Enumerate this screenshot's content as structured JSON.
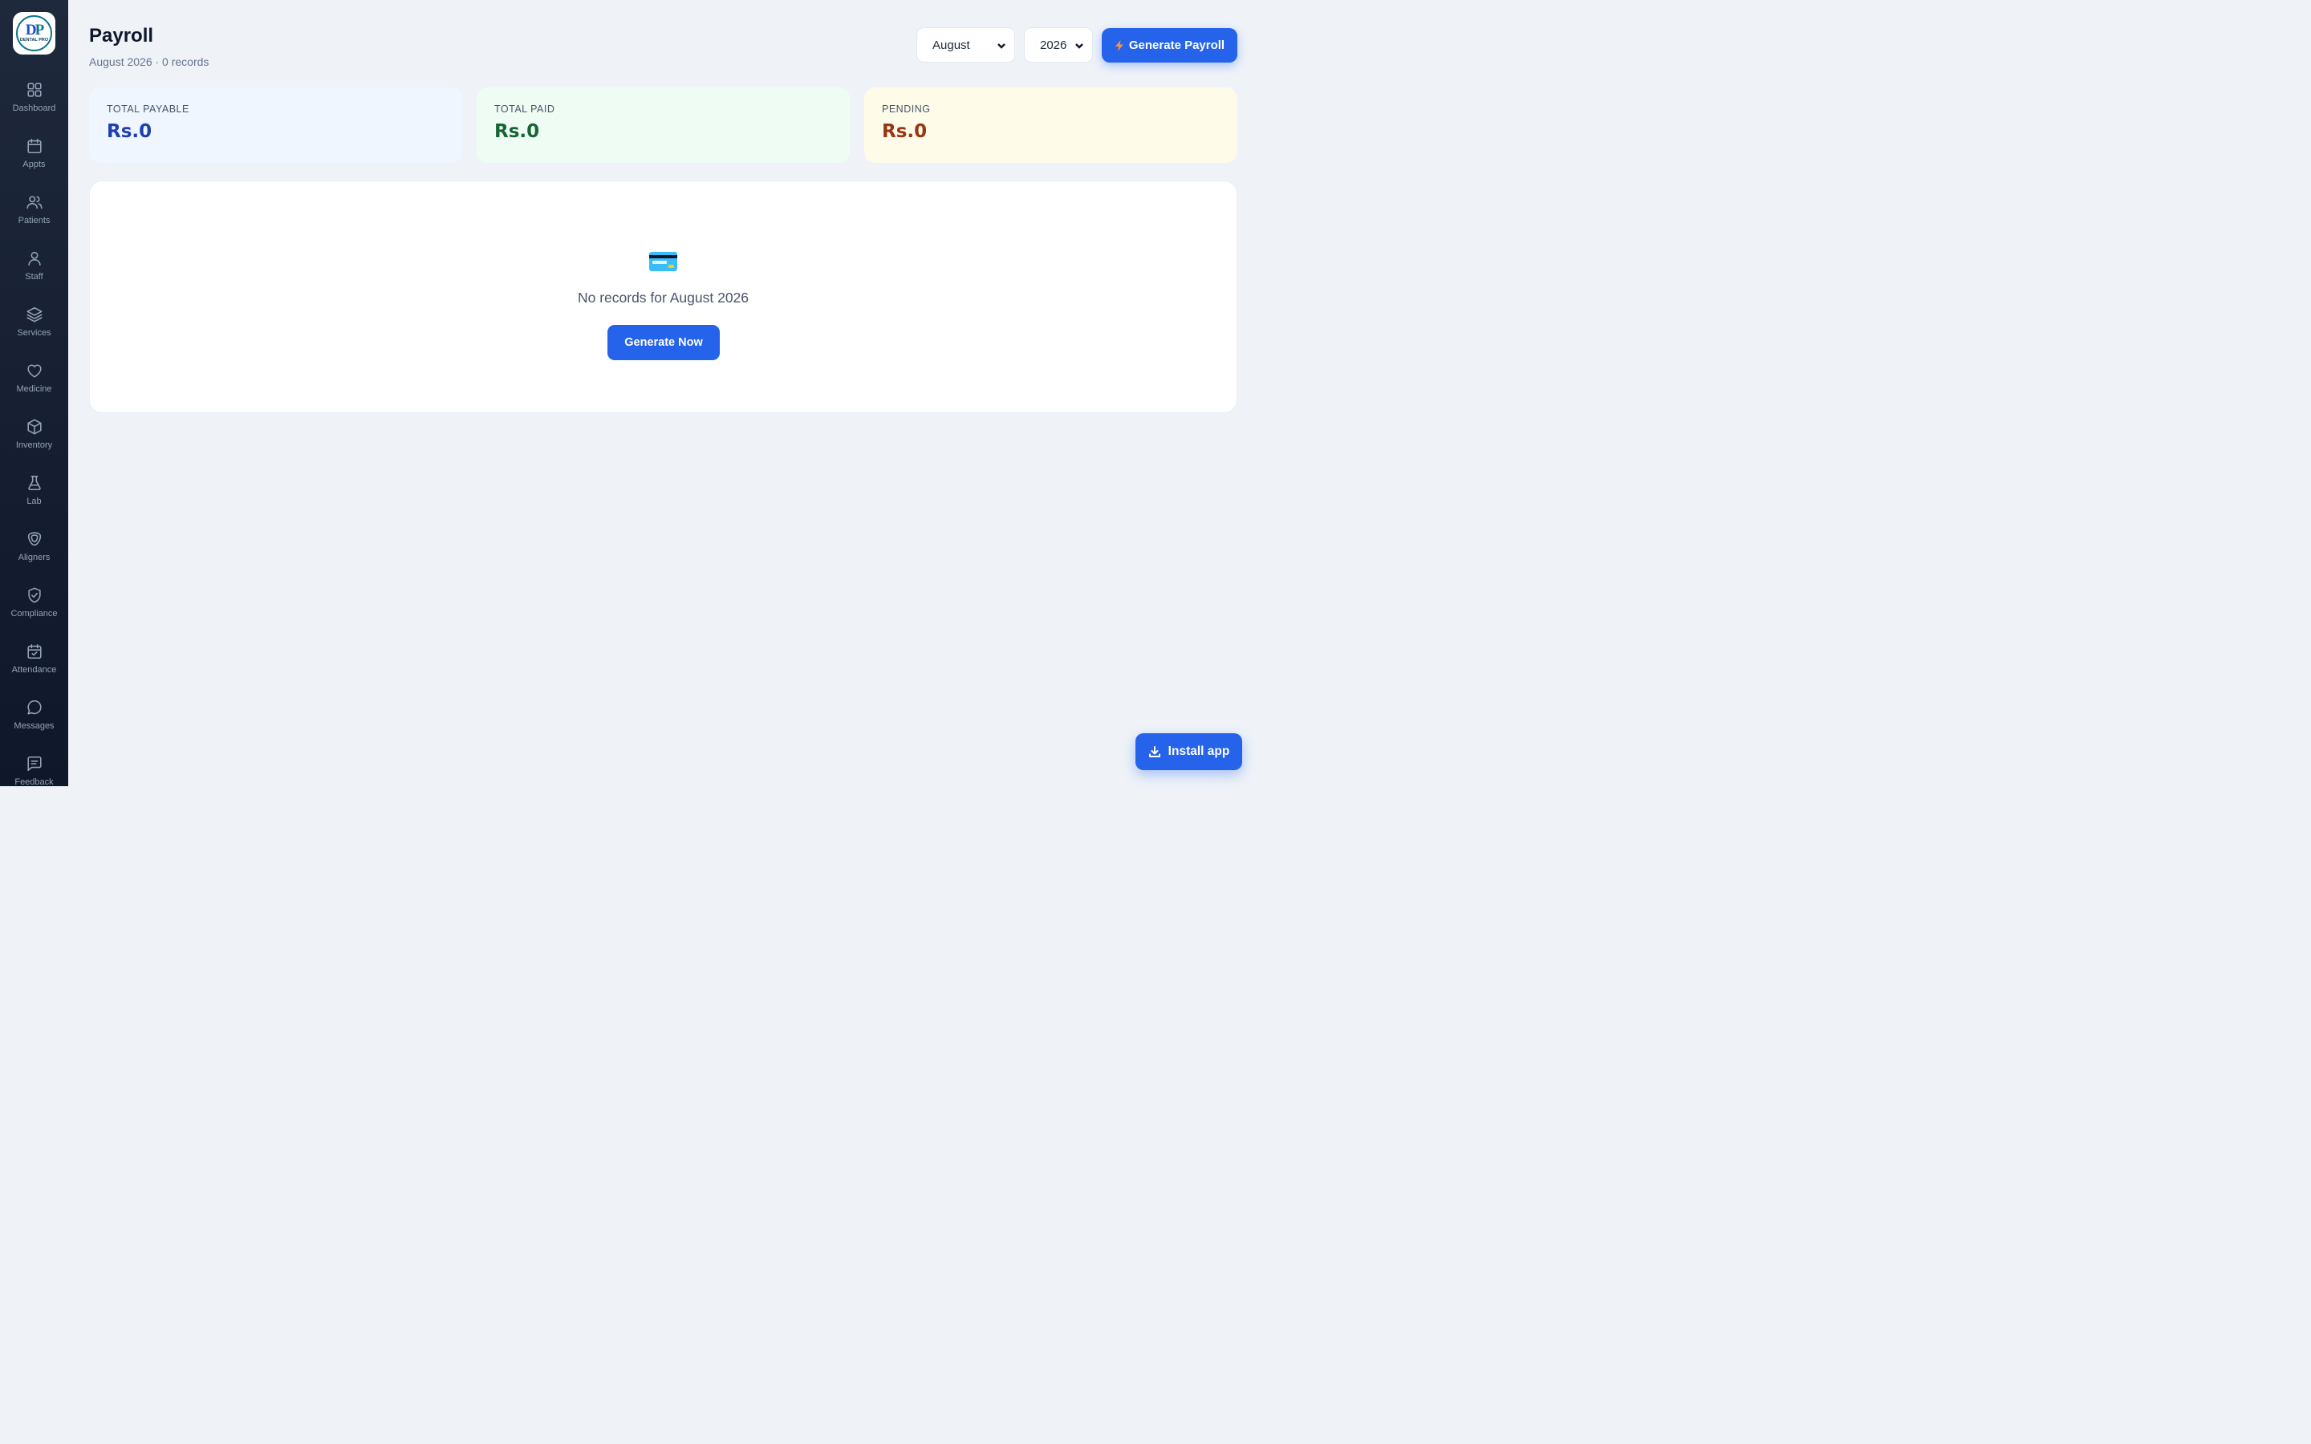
{
  "sidebar": {
    "logo": {
      "mark_d": "D",
      "mark_p": "P",
      "text": "DENTAL PRO"
    },
    "items": [
      {
        "label": "Dashboard",
        "icon": "grid-icon"
      },
      {
        "label": "Appts",
        "icon": "calendar-icon"
      },
      {
        "label": "Patients",
        "icon": "users-icon"
      },
      {
        "label": "Staff",
        "icon": "user-icon"
      },
      {
        "label": "Services",
        "icon": "layers-icon"
      },
      {
        "label": "Medicine",
        "icon": "heart-icon"
      },
      {
        "label": "Inventory",
        "icon": "box-icon"
      },
      {
        "label": "Lab",
        "icon": "flask-icon"
      },
      {
        "label": "Aligners",
        "icon": "aligner-icon"
      },
      {
        "label": "Compliance",
        "icon": "shield-check-icon"
      },
      {
        "label": "Attendance",
        "icon": "calendar-check-icon"
      },
      {
        "label": "Messages",
        "icon": "message-circle-icon"
      },
      {
        "label": "Feedback",
        "icon": "message-square-icon"
      }
    ]
  },
  "header": {
    "title": "Payroll",
    "subtitle": "August 2026 · 0 records",
    "month_select": {
      "value": "August"
    },
    "year_select": {
      "value": "2026"
    },
    "generate_label": "Generate Payroll"
  },
  "stats": [
    {
      "label": "TOTAL PAYABLE",
      "value": "Rs.0",
      "bg": "#eff6ff",
      "color": "#1e40af"
    },
    {
      "label": "TOTAL PAID",
      "value": "Rs.0",
      "bg": "#effcf4",
      "color": "#166534"
    },
    {
      "label": "PENDING",
      "value": "Rs.0",
      "bg": "#fefce8",
      "color": "#9a3412"
    }
  ],
  "empty_state": {
    "icon": "credit-card-icon",
    "message": "No records for August 2026",
    "button_label": "Generate Now"
  },
  "install_button": {
    "label": "Install app",
    "icon": "download-icon"
  },
  "colors": {
    "accent": "#2563eb",
    "sidebar_bg": "#1e293b",
    "page_bg": "#eff3f8"
  }
}
